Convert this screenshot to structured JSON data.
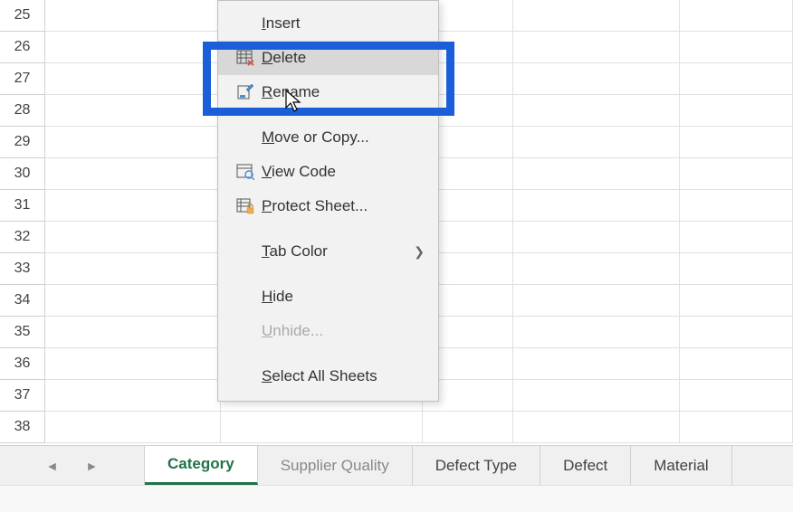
{
  "rows": [
    "25",
    "26",
    "27",
    "28",
    "29",
    "30",
    "31",
    "32",
    "33",
    "34",
    "35",
    "36",
    "37",
    "38"
  ],
  "tabs": {
    "active": "Category",
    "partial": "Supplier Quality",
    "others": [
      "Defect Type",
      "Defect",
      "Material"
    ]
  },
  "menu": {
    "insert": "Insert",
    "delete": "Delete",
    "rename": "Rename",
    "move_copy": "Move or Copy...",
    "view_code": "View Code",
    "protect": "Protect Sheet...",
    "tab_color": "Tab Color",
    "hide": "Hide",
    "unhide": "Unhide...",
    "select_all": "Select All Sheets"
  }
}
